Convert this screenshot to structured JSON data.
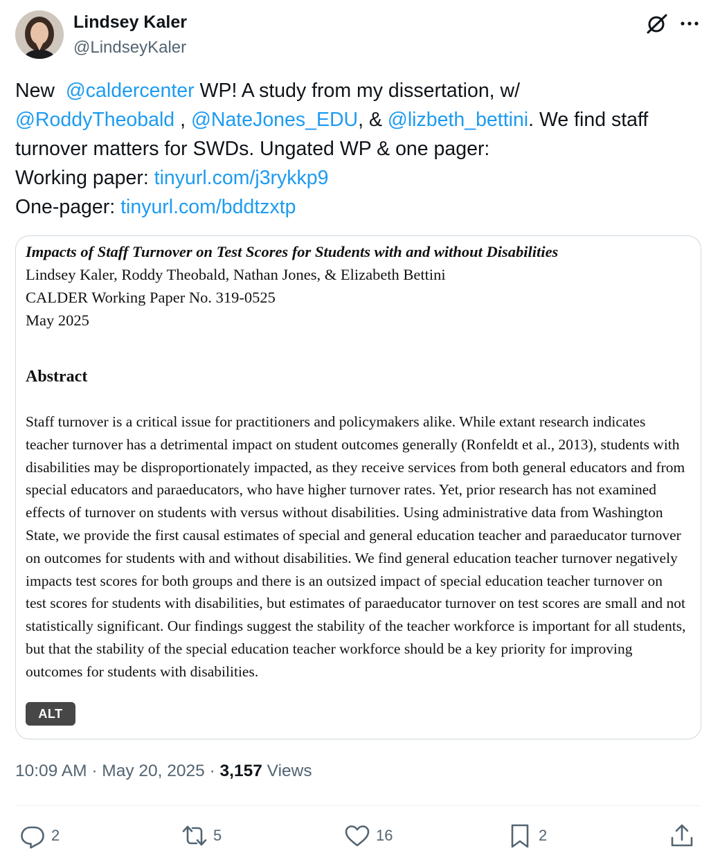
{
  "author": {
    "name": "Lindsey Kaler",
    "handle": "@LindseyKaler"
  },
  "tweet": {
    "word_new": "New",
    "mention_calder": "@caldercenter",
    "text_wp": " WP! A study from my dissertation, w/",
    "mention_roddy": "@RoddyTheobald",
    "sep1": " , ",
    "mention_nate": "@NateJones_EDU",
    "sep2": ", & ",
    "mention_lizbeth": "@lizbeth_bettini",
    "text_find": ". We find staff turnover matters for SWDs. Ungated WP & one pager:",
    "wp_label": "Working paper: ",
    "wp_link": "tinyurl.com/j3rykkp9",
    "op_label": "One-pager: ",
    "op_link": "tinyurl.com/bddtzxtp"
  },
  "media": {
    "paper_title": "Impacts of Staff Turnover on Test Scores for Students with and without Disabilities",
    "paper_authors": "Lindsey Kaler, Roddy Theobald, Nathan Jones, & Elizabeth Bettini",
    "paper_series": "CALDER Working Paper No. 319-0525",
    "paper_date": "May 2025",
    "abstract_heading": "Abstract",
    "abstract_text": "Staff turnover is a critical issue for practitioners and policymakers alike. While extant research indicates teacher turnover has a detrimental impact on student outcomes generally (Ronfeldt et al., 2013), students with disabilities may be disproportionately impacted, as they receive services from both general educators and from special educators and paraeducators, who have higher turnover rates. Yet, prior research has not examined effects of turnover on students with versus without disabilities. Using administrative data from Washington State, we provide the first causal estimates of special and general education teacher and paraeducator turnover on outcomes for students with and without disabilities. We find general education teacher turnover negatively impacts test scores for both groups and there is an outsized impact of special education teacher turnover on test scores for students with disabilities, but estimates of paraeducator turnover on test scores are small and not statistically significant. Our findings suggest the stability of the teacher workforce is important for all students, but that the stability of the special education teacher workforce should be a key priority for improving outcomes for students with disabilities.",
    "alt_label": "ALT"
  },
  "meta": {
    "time": "10:09 AM",
    "sep_a": " · ",
    "date": "May 20, 2025",
    "sep_b": " · ",
    "views_count": "3,157",
    "views_label": " Views"
  },
  "actions": {
    "replies": "2",
    "reposts": "5",
    "likes": "16",
    "bookmarks": "2"
  },
  "icons": [
    "grok-icon",
    "more-icon",
    "reply-icon",
    "repost-icon",
    "like-icon",
    "bookmark-icon",
    "share-icon"
  ],
  "colors": {
    "link": "#1d9bf0",
    "secondary": "#536471",
    "text": "#0f1419"
  }
}
